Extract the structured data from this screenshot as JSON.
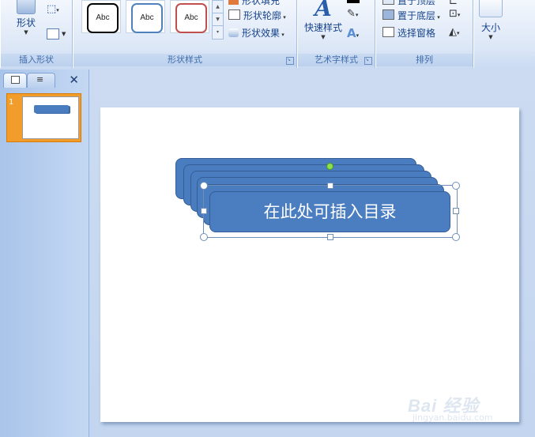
{
  "ribbon": {
    "insert_shapes": {
      "shape_button": "形状",
      "label": "插入形状"
    },
    "shape_styles": {
      "swatches": [
        "Abc",
        "Abc",
        "Abc"
      ],
      "fill_partial": "形状填充",
      "outline": "形状轮廓",
      "effects": "形状效果",
      "label": "形状样式"
    },
    "wordart_styles": {
      "quick_styles": "快速样式",
      "label": "艺术字样式"
    },
    "arrange": {
      "bring_front_partial": "置于顶层",
      "send_back": "置于底层",
      "selection_pane": "选择窗格",
      "label": "排列"
    },
    "size": {
      "label": "大小"
    }
  },
  "panel": {
    "slide_number": "1"
  },
  "slide": {
    "shape_text": "在此处可插入目录"
  },
  "watermark": {
    "brand": "Bai 经验",
    "url": "jingyan.baidu.com"
  },
  "colors": {
    "shape_fill": "#4b7dc1",
    "swatch_borders": [
      "#000000",
      "#4f81bd",
      "#c0504d"
    ],
    "thumb_highlight": "#f29c2b"
  }
}
